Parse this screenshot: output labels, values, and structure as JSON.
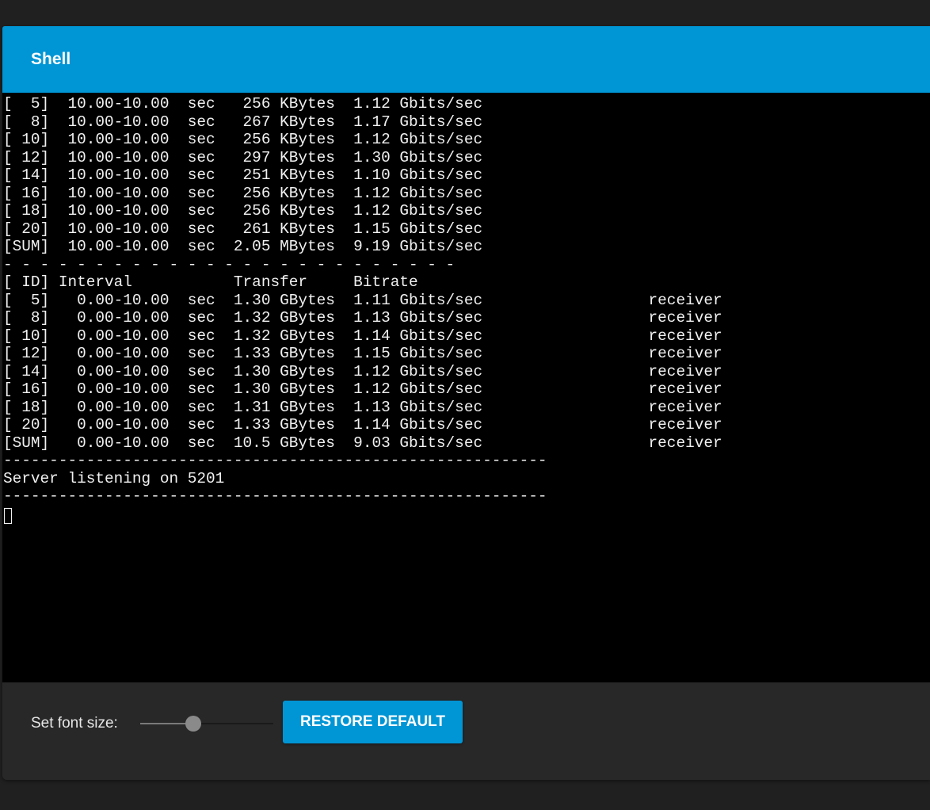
{
  "header": {
    "title": "Shell"
  },
  "terminal": {
    "lines": [
      "[  5]  10.00-10.00  sec   256 KBytes  1.12 Gbits/sec",
      "[  8]  10.00-10.00  sec   267 KBytes  1.17 Gbits/sec",
      "[ 10]  10.00-10.00  sec   256 KBytes  1.12 Gbits/sec",
      "[ 12]  10.00-10.00  sec   297 KBytes  1.30 Gbits/sec",
      "[ 14]  10.00-10.00  sec   251 KBytes  1.10 Gbits/sec",
      "[ 16]  10.00-10.00  sec   256 KBytes  1.12 Gbits/sec",
      "[ 18]  10.00-10.00  sec   256 KBytes  1.12 Gbits/sec",
      "[ 20]  10.00-10.00  sec   261 KBytes  1.15 Gbits/sec",
      "[SUM]  10.00-10.00  sec  2.05 MBytes  9.19 Gbits/sec",
      "- - - - - - - - - - - - - - - - - - - - - - - - -",
      "[ ID] Interval           Transfer     Bitrate",
      "[  5]   0.00-10.00  sec  1.30 GBytes  1.11 Gbits/sec                  receiver",
      "[  8]   0.00-10.00  sec  1.32 GBytes  1.13 Gbits/sec                  receiver",
      "[ 10]   0.00-10.00  sec  1.32 GBytes  1.14 Gbits/sec                  receiver",
      "[ 12]   0.00-10.00  sec  1.33 GBytes  1.15 Gbits/sec                  receiver",
      "[ 14]   0.00-10.00  sec  1.30 GBytes  1.12 Gbits/sec                  receiver",
      "[ 16]   0.00-10.00  sec  1.30 GBytes  1.12 Gbits/sec                  receiver",
      "[ 18]   0.00-10.00  sec  1.31 GBytes  1.13 Gbits/sec                  receiver",
      "[ 20]   0.00-10.00  sec  1.33 GBytes  1.14 Gbits/sec                  receiver",
      "[SUM]   0.00-10.00  sec  10.5 GBytes  9.03 Gbits/sec                  receiver",
      "-----------------------------------------------------------",
      "Server listening on 5201",
      "-----------------------------------------------------------"
    ]
  },
  "footer": {
    "font_size_label": "Set font size:",
    "font_size_slider_level": 0.4,
    "restore_default_label": "RESTORE DEFAULT"
  },
  "colors": {
    "accent": "#0095d5",
    "terminal_background": "#000000",
    "terminal_text": "#f0f0f0",
    "panel_background": "#282828",
    "page_background": "#202020"
  }
}
